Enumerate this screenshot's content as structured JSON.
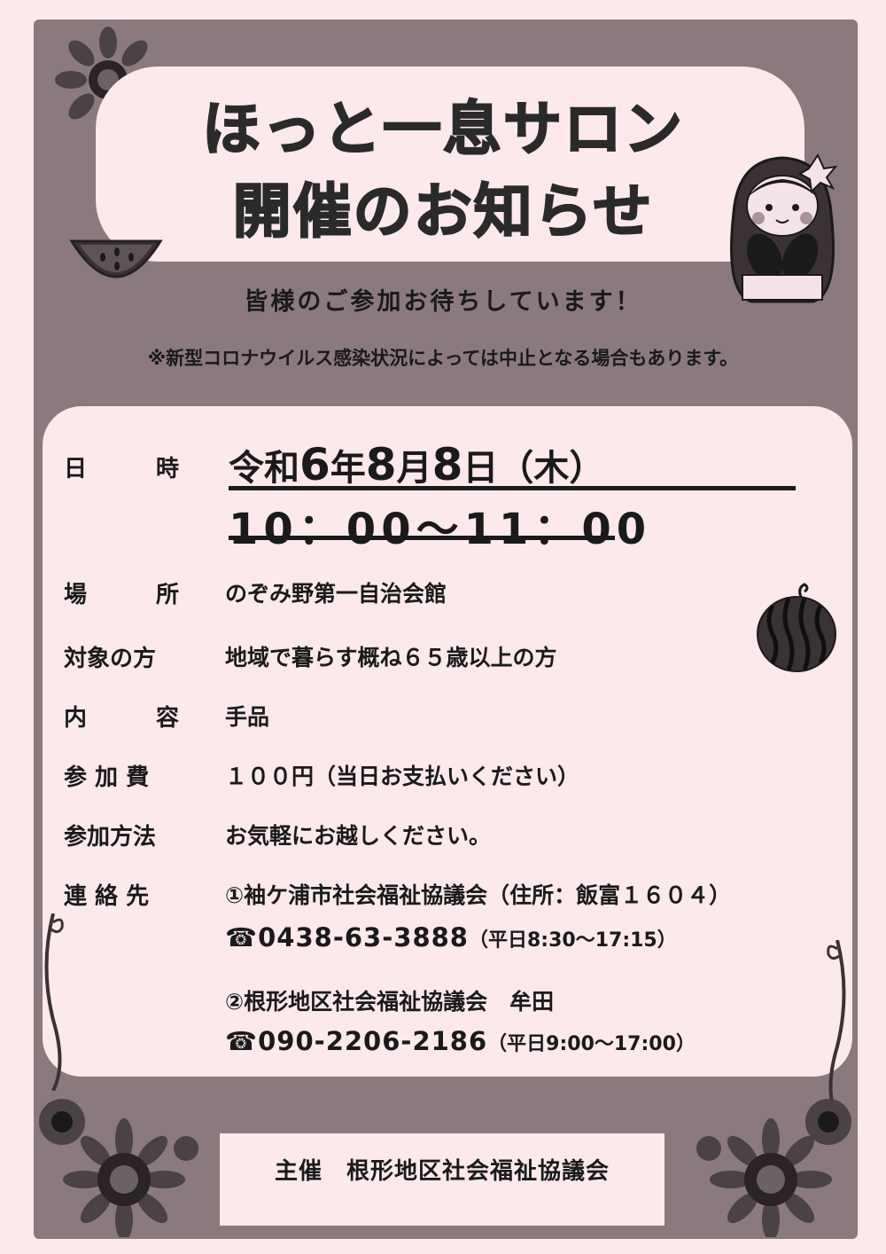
{
  "title": {
    "line1": "ほっと一息サロン",
    "line2": "開催のお知らせ"
  },
  "subtitle": "皆様のご参加お待ちしています！",
  "notice": "※新型コロナウイルス感染状況によっては中止となる場合もあります。",
  "schedule": {
    "label_1": "日",
    "label_2": "時",
    "era": "令和",
    "year": "6",
    "year_unit": "年",
    "month": "8",
    "month_unit": "月",
    "day": "8",
    "day_unit": "日",
    "weekday": "（木）",
    "time": "10：00～11：00"
  },
  "place": {
    "label_1": "場",
    "label_2": "所",
    "value": "のぞみ野第一自治会館"
  },
  "target": {
    "label": "対象の方",
    "value": "地域で暮らす概ね６５歳以上の方"
  },
  "content": {
    "label_1": "内",
    "label_2": "容",
    "value": "手品"
  },
  "fee": {
    "label": "参 加 費",
    "value": "１００円（当日お支払いください）"
  },
  "method": {
    "label": "参加方法",
    "value": "お気軽にお越しください。"
  },
  "contact": {
    "label": "連 絡 先",
    "org1": "①袖ケ浦市社会福祉協議会（住所：飯富１６０４）",
    "tel1": "☎0438-63-3888",
    "hours1": "（平日8:30～17:15）",
    "org2": "②根形地区社会福祉協議会　牟田",
    "tel2": "☎090-2206-2186",
    "hours2": "（平日9:00～17:00）"
  },
  "footer": "主催　根形地区社会福祉協議会"
}
